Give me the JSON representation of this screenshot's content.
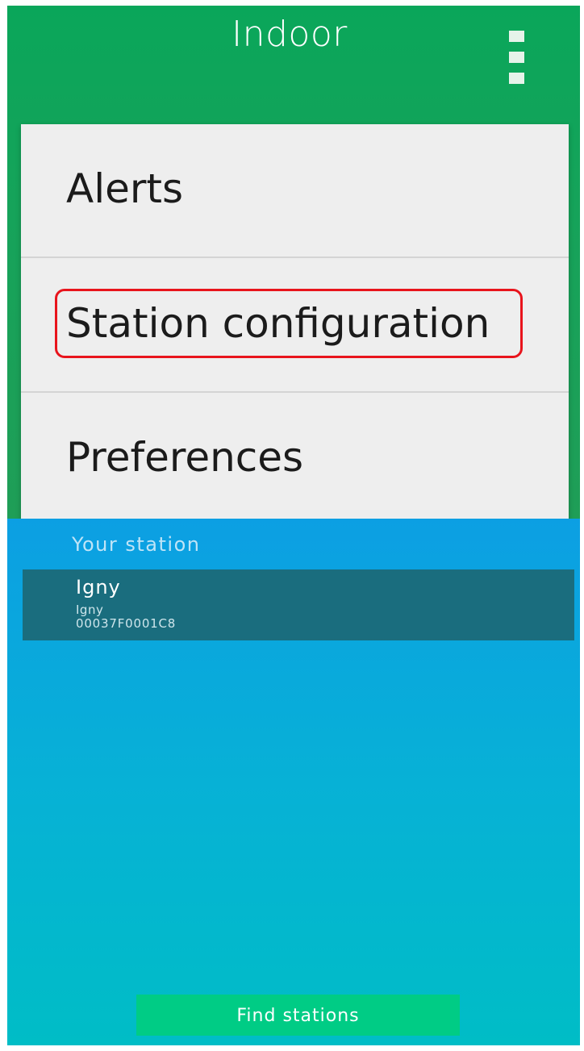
{
  "app": {
    "title": "Indoor"
  },
  "menu": {
    "items": [
      {
        "label": "Alerts"
      },
      {
        "label": "Station configuration"
      },
      {
        "label": "Preferences"
      }
    ]
  },
  "station_panel": {
    "section_title": "Your station",
    "station": {
      "name": "Igny",
      "location": "Igny",
      "id": "00037F0001C8"
    },
    "find_button_label": "Find stations"
  },
  "colors": {
    "header_green": "#0aa65a",
    "menu_background": "#eeeeee",
    "highlight_red": "#e8141c",
    "panel_blue": "#0c9fe3",
    "station_row": "#1a6d7e",
    "button_green": "#00cc85"
  },
  "icons": {
    "overflow": "overflow-menu-icon"
  }
}
